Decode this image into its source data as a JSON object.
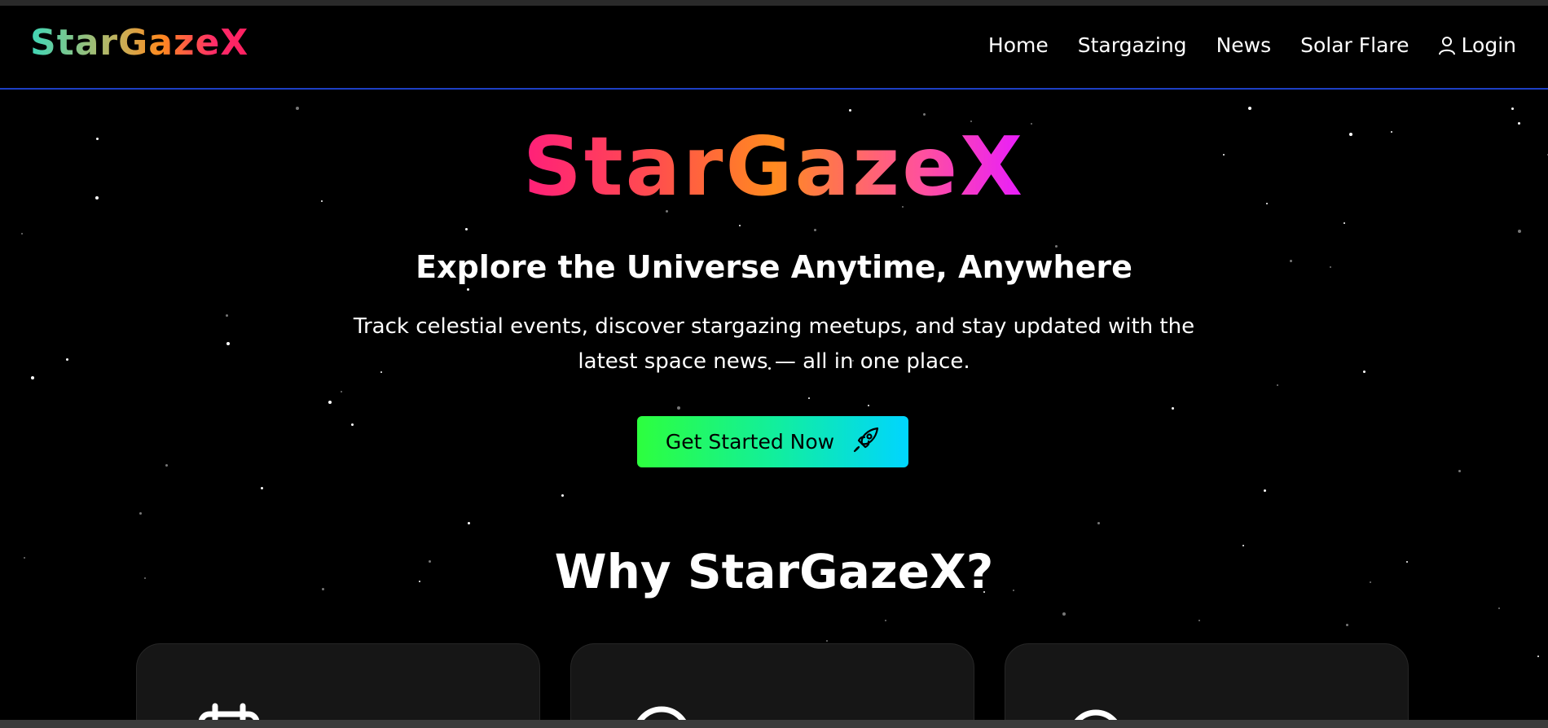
{
  "brand": {
    "logo_text": "StarGazeX",
    "gradient_colors": [
      "#3fd7b8",
      "#ff8a1f",
      "#ff2060"
    ]
  },
  "nav": {
    "items": [
      {
        "label": "Home"
      },
      {
        "label": "Stargazing"
      },
      {
        "label": "News"
      },
      {
        "label": "Solar Flare"
      },
      {
        "label": "Login",
        "icon": "user-icon"
      }
    ],
    "border_color": "#1d3fc4"
  },
  "hero": {
    "title": "StarGazeX",
    "subtitle": "Explore the Universe Anytime, Anywhere",
    "description": "Track celestial events, discover stargazing meetups, and stay updated with the latest space news — all in one place.",
    "cta_label": "Get Started Now",
    "cta_icon": "rocket-icon",
    "title_gradient": [
      "#ff1f7a",
      "#ff8a1f",
      "#e81cff"
    ],
    "cta_gradient": [
      "#2dff3e",
      "#00d5ff"
    ]
  },
  "features": {
    "title": "Why StarGazeX?",
    "cards": [
      {
        "icon": "calendar-icon"
      },
      {
        "icon": "location-pin-icon"
      },
      {
        "icon": "compass-icon"
      }
    ]
  }
}
